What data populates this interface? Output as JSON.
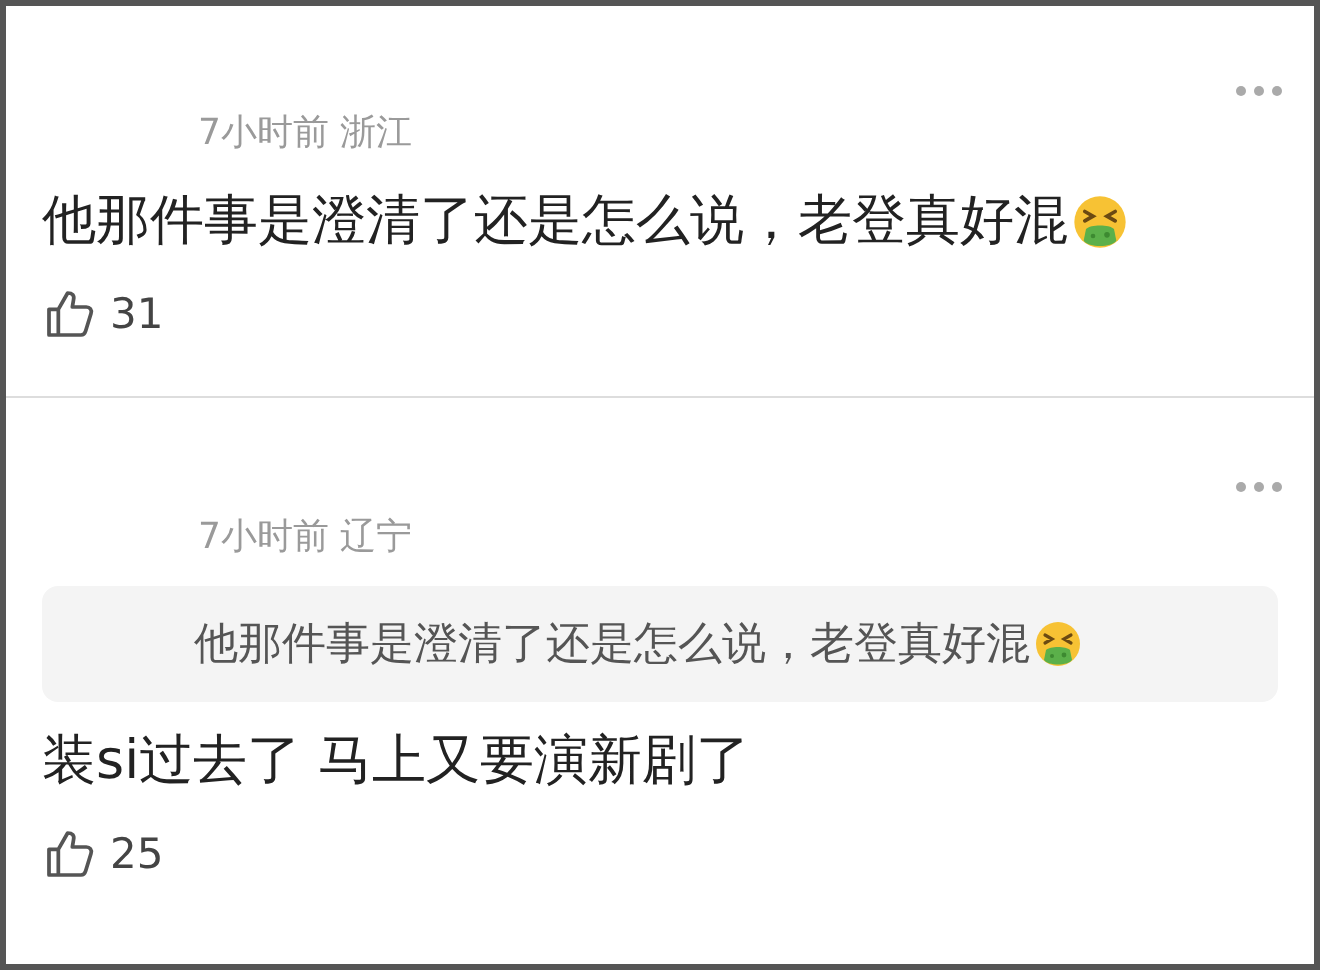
{
  "comments": [
    {
      "time": "7小时前",
      "location": "浙江",
      "text": "他那件事是澄清了还是怎么说，老登真好混",
      "trailing_emoji": true,
      "likes": "31"
    },
    {
      "time": "7小时前",
      "location": "辽宁",
      "quote": {
        "text": "他那件事是澄清了还是怎么说，老登真好混",
        "trailing_emoji": true
      },
      "text": "装si过去了 马上又要演新剧了",
      "trailing_emoji": false,
      "likes": "25"
    }
  ]
}
